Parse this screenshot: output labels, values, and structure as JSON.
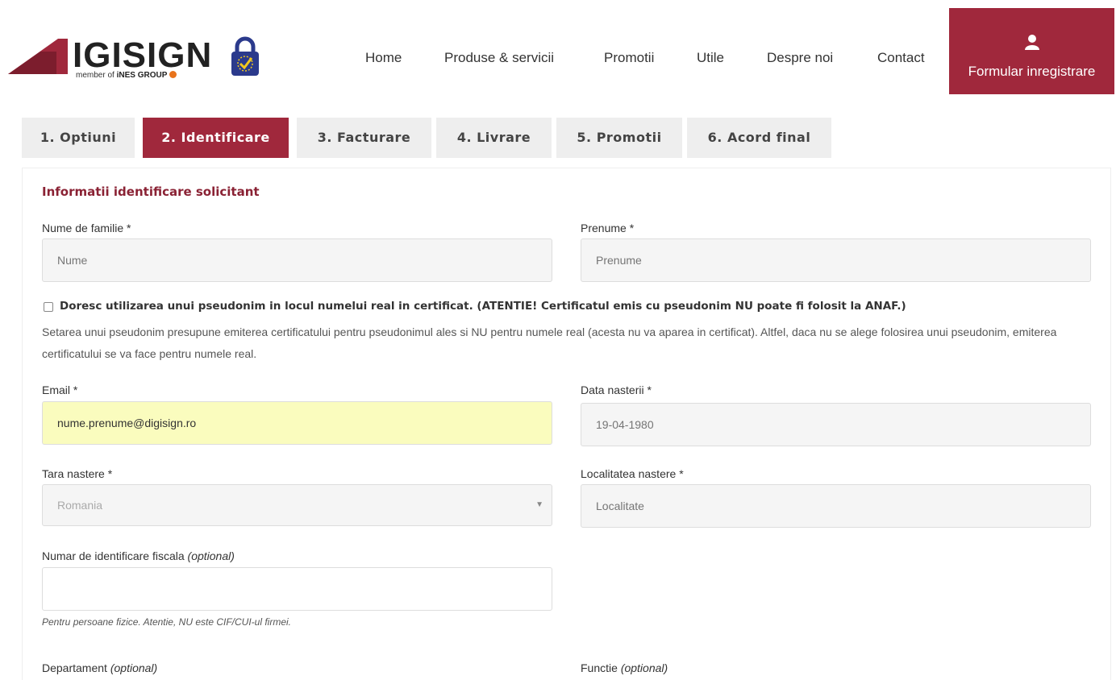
{
  "brand": {
    "name": "IGISIGN",
    "member_prefix": "member of ",
    "member_group": "iNES GROUP"
  },
  "nav": {
    "items": [
      "Home",
      "Produse & servicii",
      "Promotii",
      "Utile",
      "Despre noi",
      "Contact"
    ],
    "cta_label": "Formular inregistrare"
  },
  "tabs": [
    {
      "label": "1. Optiuni",
      "active": false
    },
    {
      "label": "2. Identificare",
      "active": true
    },
    {
      "label": "3. Facturare",
      "active": false
    },
    {
      "label": "4. Livrare",
      "active": false
    },
    {
      "label": "5. Promotii",
      "active": false
    },
    {
      "label": "6. Acord final",
      "active": false
    }
  ],
  "form": {
    "section_title": "Informatii identificare solicitant",
    "last_name": {
      "label": "Nume de familie *",
      "placeholder": "Nume",
      "value": ""
    },
    "first_name": {
      "label": "Prenume *",
      "placeholder": "Prenume",
      "value": ""
    },
    "pseudonym": {
      "checked": false,
      "label": "Doresc utilizarea unui pseudonim in locul numelui real in certificat. (ATENTIE! Certificatul emis cu pseudonim NU poate fi folosit la ANAF.)",
      "description": "Setarea unui pseudonim presupune emiterea certificatului pentru pseudonimul ales si NU pentru numele real (acesta nu va aparea in certificat). Altfel, daca nu se alege folosirea unui pseudonim, emiterea certificatului se va face pentru numele real."
    },
    "email": {
      "label": "Email *",
      "value": "nume.prenume@digisign.ro"
    },
    "birth_date": {
      "label": "Data nasterii *",
      "placeholder": "19-04-1980"
    },
    "birth_country": {
      "label": "Tara nastere *",
      "selected": "Romania"
    },
    "birth_city": {
      "label": "Localitatea nastere *",
      "placeholder": "Localitate"
    },
    "tax_id": {
      "label_main": "Numar de identificare fiscala ",
      "label_optional": "(optional)",
      "value": "",
      "hint": "Pentru persoane fizice. Atentie, NU este CIF/CUI-ul firmei."
    },
    "department": {
      "label_main": "Departament ",
      "label_optional": "(optional)"
    },
    "position": {
      "label_main": "Functie ",
      "label_optional": "(optional)"
    }
  },
  "colors": {
    "accent": "#a0283c",
    "section_title": "#8a2234",
    "tab_inactive_bg": "#eeeeee",
    "autofill_bg": "#fafcbe"
  }
}
